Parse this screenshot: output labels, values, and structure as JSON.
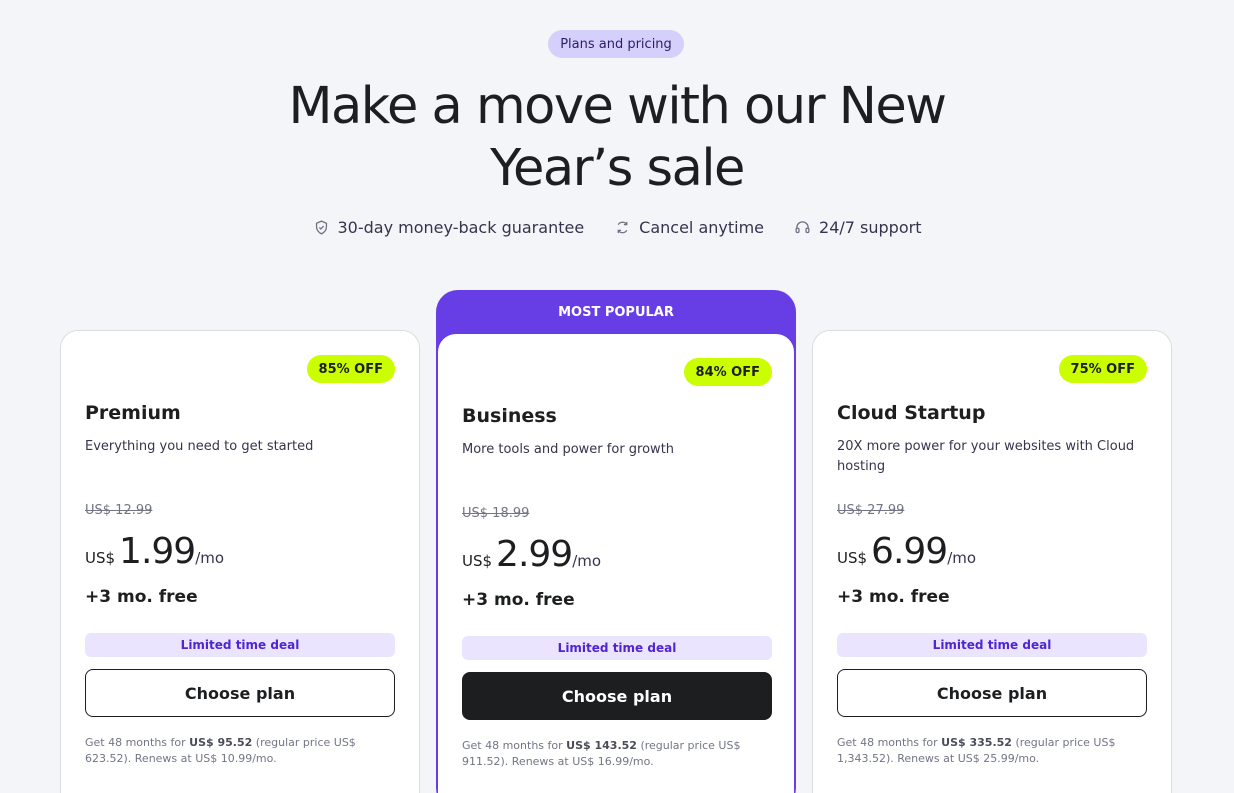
{
  "pill": "Plans and pricing",
  "headline": {
    "line1": "Make a move with our New",
    "line2": "Year’s sale"
  },
  "guarantees": [
    {
      "icon": "shield-check-icon",
      "label": "30-day money-back guarantee"
    },
    {
      "icon": "refresh-icon",
      "label": "Cancel anytime"
    },
    {
      "icon": "headset-icon",
      "label": "24/7 support"
    }
  ],
  "popular_label": "MOST POPULAR",
  "plans": [
    {
      "discount": "85% OFF",
      "name": "Premium",
      "description": "Everything you need to get started",
      "old_price": "US$ 12.99",
      "currency": "US$",
      "price": "1.99",
      "period": "/mo",
      "free": "+3 mo. free",
      "deal": "Limited time deal",
      "cta": "Choose plan",
      "fine_prefix": "Get 48 months for ",
      "fine_total": "US$ 95.52",
      "fine_suffix": " (regular price US$ 623.52). Renews at US$ 10.99/mo."
    },
    {
      "discount": "84% OFF",
      "name": "Business",
      "description": "More tools and power for growth",
      "old_price": "US$ 18.99",
      "currency": "US$",
      "price": "2.99",
      "period": "/mo",
      "free": "+3 mo. free",
      "deal": "Limited time deal",
      "cta": "Choose plan",
      "fine_prefix": "Get 48 months for ",
      "fine_total": "US$ 143.52",
      "fine_suffix": " (regular price US$ 911.52). Renews at US$ 16.99/mo."
    },
    {
      "discount": "75% OFF",
      "name": "Cloud Startup",
      "description": "20X more power for your websites with Cloud hosting",
      "old_price": "US$ 27.99",
      "currency": "US$",
      "price": "6.99",
      "period": "/mo",
      "free": "+3 mo. free",
      "deal": "Limited time deal",
      "cta": "Choose plan",
      "fine_prefix": "Get 48 months for ",
      "fine_total": "US$ 335.52",
      "fine_suffix": " (regular price US$ 1,343.52). Renews at US$ 25.99/mo."
    }
  ],
  "colors": {
    "background": "#f4f5f8",
    "accent_purple": "#673de6",
    "pill_bg": "#d5d0fb",
    "discount_bg": "#cbff00",
    "deal_bg": "#ebe4ff",
    "deal_text": "#5025d1",
    "dark_button": "#1d1e20"
  }
}
